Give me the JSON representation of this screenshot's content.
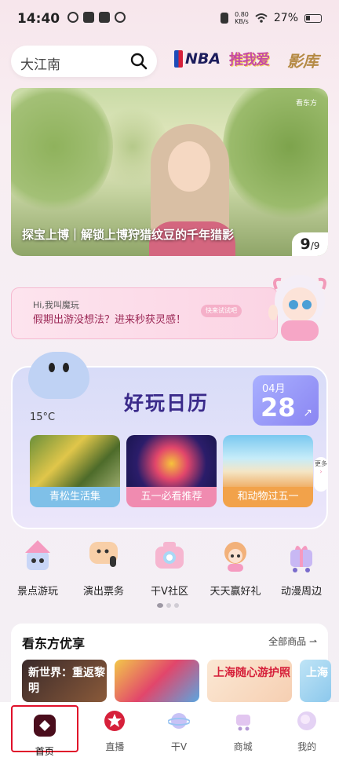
{
  "status_bar": {
    "time": "14:40",
    "net_speed_value": "0.80",
    "net_speed_unit": "KB/s",
    "battery": "27%"
  },
  "header": {
    "search_placeholder": "大江南",
    "nba_logo": "NBA",
    "logo_2": "推我爱",
    "logo_3": "影库"
  },
  "banner": {
    "brand": "看东方",
    "title": "探宝上博｜解锁上博狩猎纹豆的千年猎影",
    "counter_current": "9",
    "counter_total": "/9"
  },
  "ai_promo": {
    "greeting": "Hi,我叫魔玩",
    "message": "假期出游没想法？进来秒获灵感！",
    "button": "快来试试吧"
  },
  "calendar": {
    "title": "好玩日历",
    "month": "04月",
    "day": "28",
    "temperature": "15°C",
    "more_label": "更多",
    "tiles": [
      {
        "label": "青松生活集",
        "color": "#7fc0e8"
      },
      {
        "label": "五一必看推荐",
        "color": "#f08bb0"
      },
      {
        "label": "和动物过五一",
        "color": "#f2a24a"
      }
    ]
  },
  "quick_links": [
    {
      "label": "景点游玩",
      "icon": "castle-icon"
    },
    {
      "label": "演出票务",
      "icon": "microphone-icon"
    },
    {
      "label": "干V社区",
      "icon": "camera-icon"
    },
    {
      "label": "天天赢好礼",
      "icon": "doll-icon"
    },
    {
      "label": "动漫周边",
      "icon": "gift-cart-icon"
    }
  ],
  "shop": {
    "title": "看东方优享",
    "all_label": "全部商品",
    "items": [
      {
        "text": "新世界：重返黎明"
      },
      {
        "text": ""
      },
      {
        "text": "上海随心游护照"
      },
      {
        "text": "上海"
      }
    ]
  },
  "tabbar": {
    "tabs": [
      {
        "label": "首页"
      },
      {
        "label": "直播"
      },
      {
        "label": "干V"
      },
      {
        "label": "商城"
      },
      {
        "label": "我的"
      }
    ]
  },
  "colors": {
    "accent_pink": "#f08bb0",
    "active_outline": "#e0102a",
    "calendar_purple": "#3a2a8a"
  }
}
